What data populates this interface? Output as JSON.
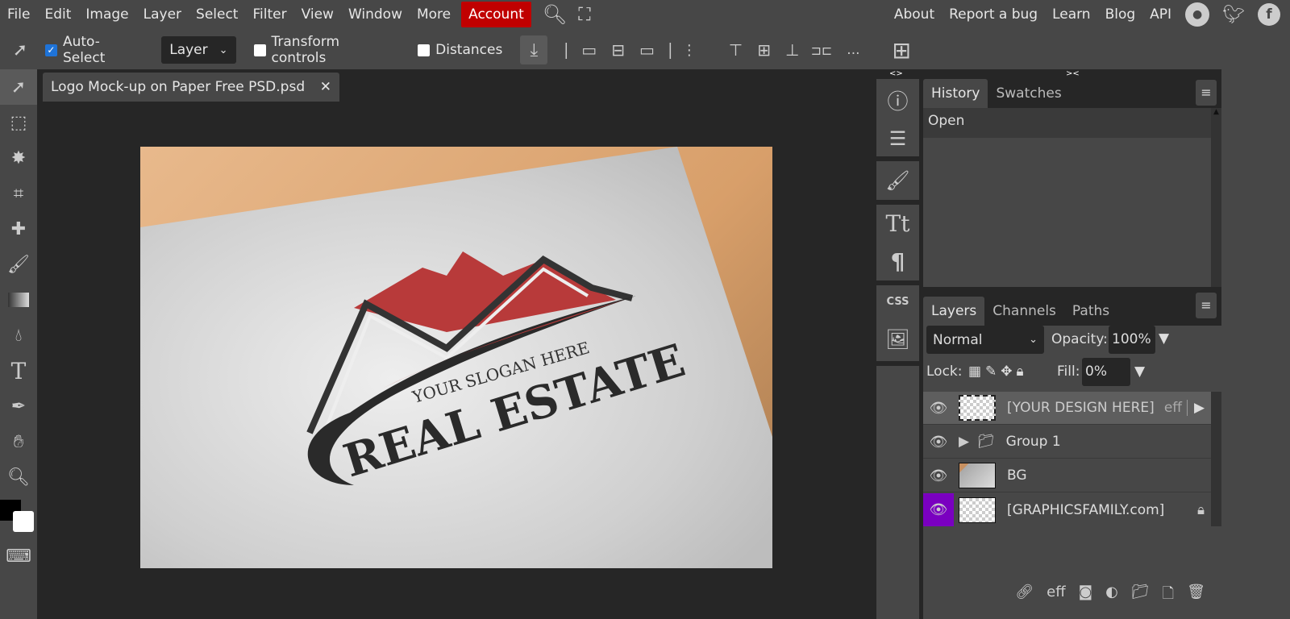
{
  "menu": {
    "items": [
      "File",
      "Edit",
      "Image",
      "Layer",
      "Select",
      "Filter",
      "View",
      "Window",
      "More"
    ],
    "account": "Account",
    "right": [
      "About",
      "Report a bug",
      "Learn",
      "Blog",
      "API"
    ]
  },
  "options": {
    "auto_select": "Auto-Select",
    "auto_select_checked": true,
    "select_target": "Layer",
    "transform_controls": "Transform controls",
    "distances": "Distances",
    "more": "..."
  },
  "document": {
    "tab_title": "Logo Mock-up on Paper Free PSD.psd",
    "close": "✕",
    "logo_slogan": "YOUR SLOGAN HERE",
    "logo_title": "REAL ESTATE"
  },
  "history_panel": {
    "tabs": [
      "History",
      "Swatches"
    ],
    "items": [
      "Open"
    ],
    "collapse_left": "<>",
    "collapse_right": "><"
  },
  "layers_panel": {
    "tabs": [
      "Layers",
      "Channels",
      "Paths"
    ],
    "blend_mode": "Normal",
    "opacity_label": "Opacity:",
    "opacity": "100%",
    "lock_label": "Lock:",
    "fill_label": "Fill:",
    "fill": "0%",
    "layers": [
      {
        "name": "[YOUR DESIGN HERE]",
        "fx": "eff",
        "selected": true
      },
      {
        "name": "Group 1"
      },
      {
        "name": "BG"
      },
      {
        "name": "[GRAPHICSFAMILY.com]",
        "locked": true
      }
    ],
    "footer_fx": "eff"
  },
  "colors": {
    "account": "#c00000",
    "selected_eye": "#7a00c0",
    "bg": "#474747",
    "workspace": "#262626"
  }
}
